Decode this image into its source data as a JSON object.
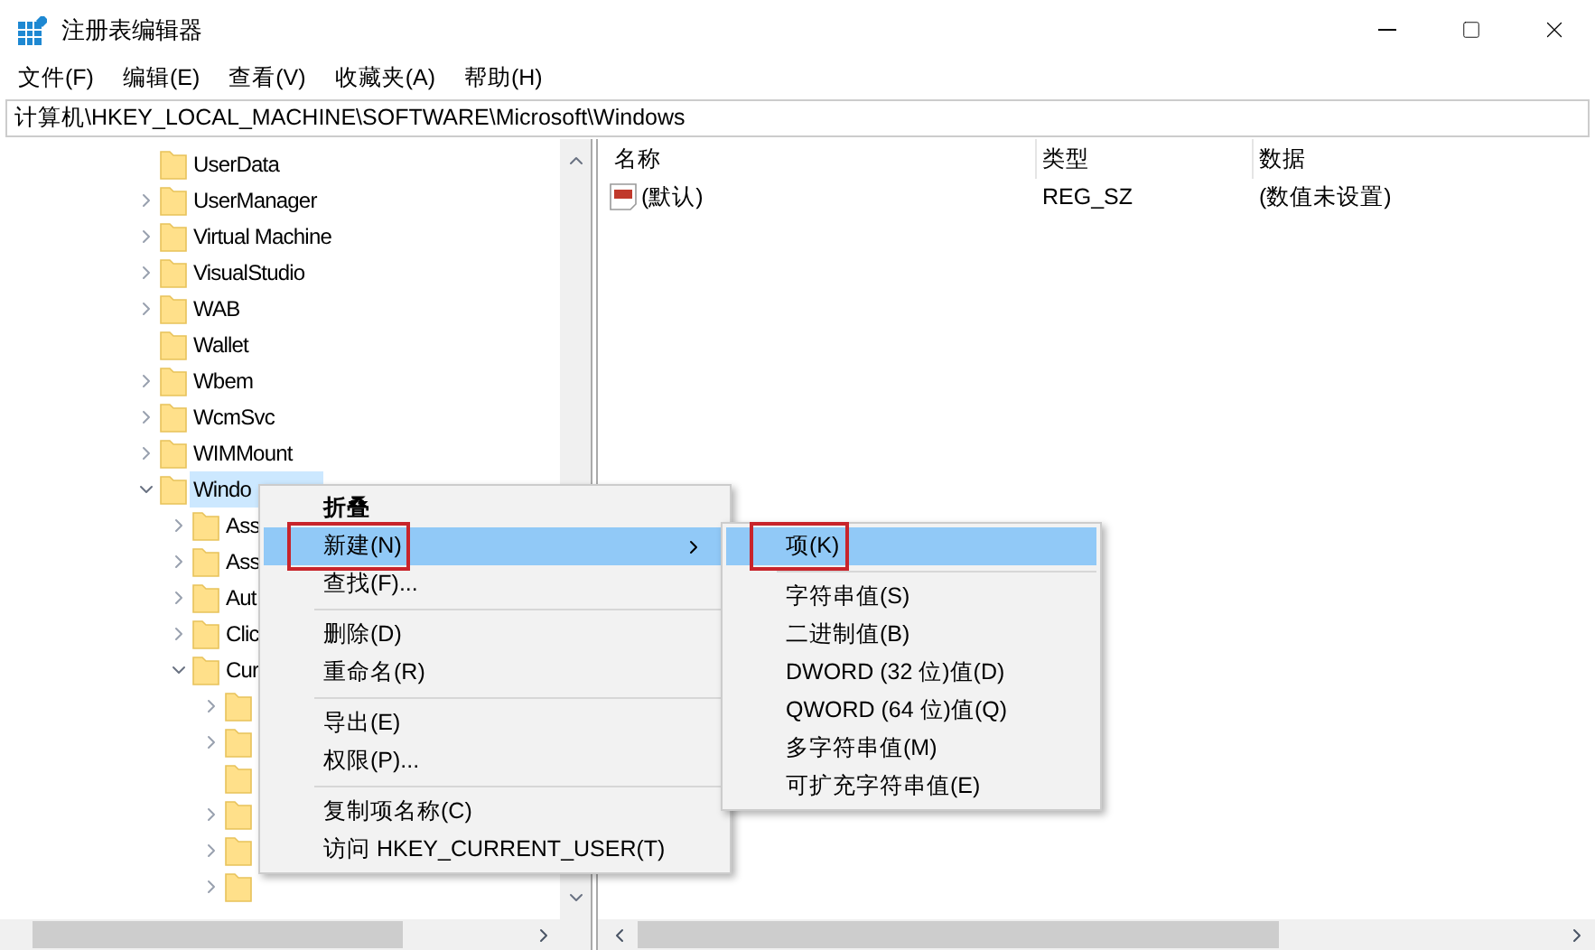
{
  "window": {
    "title": "注册表编辑器"
  },
  "menu_bar": [
    "文件(F)",
    "编辑(E)",
    "查看(V)",
    "收藏夹(A)",
    "帮助(H)"
  ],
  "address_bar": "计算机\\HKEY_LOCAL_MACHINE\\SOFTWARE\\Microsoft\\Windows",
  "tree": {
    "items": [
      {
        "name": "UserData",
        "expandable": false
      },
      {
        "name": "UserManager",
        "expandable": true
      },
      {
        "name": "Virtual Machine",
        "expandable": true
      },
      {
        "name": "VisualStudio",
        "expandable": true
      },
      {
        "name": "WAB",
        "expandable": true
      },
      {
        "name": "Wallet",
        "expandable": false
      },
      {
        "name": "Wbem",
        "expandable": true
      },
      {
        "name": "WcmSvc",
        "expandable": true
      },
      {
        "name": "WIMMount",
        "expandable": true
      },
      {
        "name": "Windo",
        "expandable": true,
        "expanded": true,
        "selected": true,
        "children": [
          {
            "name": "Ass",
            "expandable": true
          },
          {
            "name": "Ass",
            "expandable": true
          },
          {
            "name": "Aut",
            "expandable": true
          },
          {
            "name": "Clic",
            "expandable": true
          },
          {
            "name": "Cur",
            "expandable": true,
            "expanded": true,
            "children": [
              {
                "expandable": true
              },
              {
                "expandable": true
              },
              {
                "expandable": false
              },
              {
                "expandable": true
              },
              {
                "expandable": true
              },
              {
                "expandable": true
              }
            ]
          }
        ]
      }
    ]
  },
  "values_table": {
    "columns": [
      "名称",
      "类型",
      "数据"
    ],
    "rows": [
      {
        "name": "(默认)",
        "type": "REG_SZ",
        "data": "(数值未设置)"
      }
    ]
  },
  "context_menu": {
    "items": [
      {
        "kind": "item",
        "label": "折叠",
        "bold": true,
        "selected": false
      },
      {
        "kind": "item",
        "label": "新建(N)",
        "submenu": true,
        "selected": true,
        "annotated": true
      },
      {
        "kind": "item",
        "label": "查找(F)...",
        "selected": false
      },
      {
        "kind": "separator"
      },
      {
        "kind": "item",
        "label": "删除(D)",
        "selected": false
      },
      {
        "kind": "item",
        "label": "重命名(R)",
        "selected": false
      },
      {
        "kind": "separator"
      },
      {
        "kind": "item",
        "label": "导出(E)",
        "selected": false
      },
      {
        "kind": "item",
        "label": "权限(P)...",
        "selected": false
      },
      {
        "kind": "separator"
      },
      {
        "kind": "item",
        "label": "复制项名称(C)",
        "selected": false
      },
      {
        "kind": "item",
        "label": "访问 HKEY_CURRENT_USER(T)",
        "selected": false
      }
    ]
  },
  "submenu": {
    "items": [
      {
        "kind": "item",
        "label": "项(K)",
        "selected": true,
        "annotated": true
      },
      {
        "kind": "separator"
      },
      {
        "kind": "item",
        "label": "字符串值(S)",
        "selected": false
      },
      {
        "kind": "item",
        "label": "二进制值(B)",
        "selected": false
      },
      {
        "kind": "item",
        "label": "DWORD (32 位)值(D)",
        "selected": false
      },
      {
        "kind": "item",
        "label": "QWORD (64 位)值(Q)",
        "selected": false
      },
      {
        "kind": "item",
        "label": "多字符串值(M)",
        "selected": false
      },
      {
        "kind": "item",
        "label": "可扩充字符串值(E)",
        "selected": false
      }
    ]
  }
}
